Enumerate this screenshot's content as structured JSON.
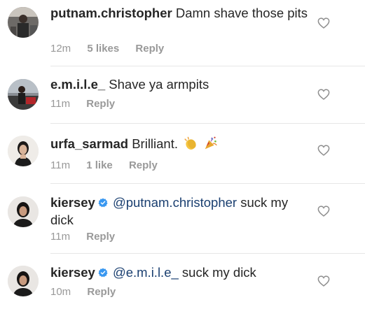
{
  "comments": [
    {
      "username": "putnam.christopher",
      "text": "Damn shave those pits",
      "time": "12m",
      "likes": "5 likes",
      "reply": "Reply",
      "heart_icon": "heart-outline-icon"
    },
    {
      "username": "e.m.i.l.e_",
      "text": "Shave ya armpits",
      "time": "11m",
      "reply": "Reply",
      "heart_icon": "heart-outline-icon"
    },
    {
      "username": "urfa_sarmad",
      "text": "Brilliant.",
      "emojis": [
        "clapping-hands-emoji",
        "party-popper-emoji"
      ],
      "time": "11m",
      "likes": "1 like",
      "reply": "Reply",
      "heart_icon": "heart-outline-icon"
    },
    {
      "username": "kiersey",
      "verified_icon": "verified-badge-icon",
      "mention": "@putnam.christopher",
      "text": "suck my dick",
      "time": "11m",
      "reply": "Reply",
      "heart_icon": "heart-outline-icon"
    },
    {
      "username": "kiersey",
      "verified_icon": "verified-badge-icon",
      "mention": "@e.m.i.l.e_",
      "text": "suck my dick",
      "time": "10m",
      "reply": "Reply",
      "heart_icon": "heart-outline-icon"
    }
  ],
  "colors": {
    "text": "#262626",
    "meta": "#999999",
    "mention": "#1a3f70",
    "verified": "#3897f0",
    "divider": "#e6e6e6"
  }
}
